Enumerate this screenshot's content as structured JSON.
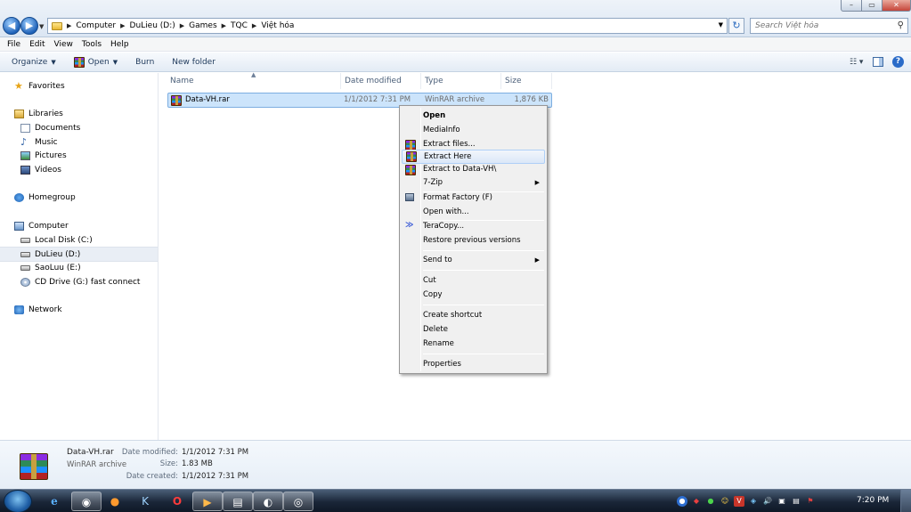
{
  "window": {
    "controls": {
      "minimize": "–",
      "maximize": "▭",
      "close": "✕"
    }
  },
  "address": {
    "crumbs": [
      "Computer",
      "DuLieu (D:)",
      "Games",
      "TQC",
      "Việt hóa"
    ]
  },
  "search": {
    "placeholder": "Search Việt hóa"
  },
  "menubar": [
    "File",
    "Edit",
    "View",
    "Tools",
    "Help"
  ],
  "toolbar": {
    "organize": "Organize",
    "open": "Open",
    "burn": "Burn",
    "new_folder": "New folder"
  },
  "sidebar": {
    "favorites": "Favorites",
    "libraries": "Libraries",
    "documents": "Documents",
    "music": "Music",
    "pictures": "Pictures",
    "videos": "Videos",
    "homegroup": "Homegroup",
    "computer": "Computer",
    "local_disk": "Local Disk (C:)",
    "dulieu": "DuLieu (D:)",
    "saoluu": "SaoLuu (E:)",
    "cd_drive": "CD Drive (G:) fast connect",
    "network": "Network"
  },
  "columns": {
    "name": "Name",
    "date": "Date modified",
    "type": "Type",
    "size": "Size"
  },
  "files": [
    {
      "name": "Data-VH.rar",
      "date": "1/1/2012 7:31 PM",
      "type": "WinRAR archive",
      "size": "1,876 KB"
    }
  ],
  "context_menu": {
    "open": "Open",
    "mediainfo": "MediaInfo",
    "extract_files": "Extract files...",
    "extract_here": "Extract Here",
    "extract_to": "Extract to Data-VH\\",
    "seven_zip": "7-Zip",
    "format_factory": "Format Factory (F)",
    "open_with": "Open with...",
    "teracopy": "TeraCopy...",
    "restore": "Restore previous versions",
    "send_to": "Send to",
    "cut": "Cut",
    "copy": "Copy",
    "create_shortcut": "Create shortcut",
    "delete": "Delete",
    "rename": "Rename",
    "properties": "Properties"
  },
  "details": {
    "name": "Data-VH.rar",
    "type": "WinRAR archive",
    "date_modified_label": "Date modified:",
    "date_modified": "1/1/2012 7:31 PM",
    "size_label": "Size:",
    "size": "1.83 MB",
    "date_created_label": "Date created:",
    "date_created": "1/1/2012 7:31 PM"
  },
  "taskbar": {
    "clock": "7:20 PM"
  },
  "colors": {
    "selection": "#cce4fb",
    "taskbar": "#1a2638",
    "accent": "#1f62b8"
  }
}
